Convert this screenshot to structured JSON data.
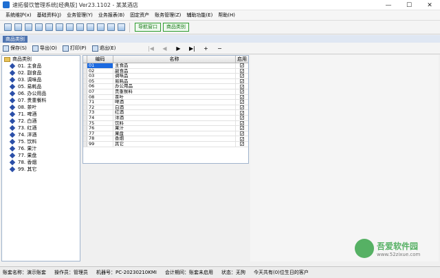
{
  "window": {
    "title": "速拓餐饮管理系统[经典版] Ver23.1102 - 某某酒店",
    "minimize": "—",
    "maximize": "☐",
    "close": "✕"
  },
  "menu": [
    "系统维护(x)",
    "基础资料(J)",
    "业务管理(Y)",
    "业务报表(B)",
    "固定资产",
    "账务管理(Z)",
    "辅助功能(E)",
    "帮助(H)"
  ],
  "toolbar": {
    "tab1": "导航窗口",
    "tab2": "商品类别"
  },
  "mdi_tab": "商品类别",
  "actions": {
    "save": "保存(S)",
    "export": "导出(O)",
    "print": "打印(P)",
    "exit": "退出(E)"
  },
  "nav": {
    "first": "|◀",
    "prev": "◀",
    "next": "▶",
    "last": "▶|",
    "add": "+",
    "remove": "−"
  },
  "tree": {
    "root": "商品类别",
    "items": [
      "01. 主食品",
      "02. 副食品",
      "03. 调味品",
      "05. 易耗品",
      "06. 办公用品",
      "07. 贵重餐料",
      "08. 茶叶",
      "71. 啤酒",
      "72. 白酒",
      "73. 红酒",
      "74. 洋酒",
      "75. 饮料",
      "76. 果汁",
      "77. 果盘",
      "78. 香烟",
      "99. 其它"
    ]
  },
  "grid": {
    "headers": {
      "code": "编码",
      "name": "名称",
      "enabled": "启用"
    },
    "rows": [
      {
        "code": "01",
        "name": "主食品",
        "enabled": true
      },
      {
        "code": "02",
        "name": "副食品",
        "enabled": true
      },
      {
        "code": "03",
        "name": "调味品",
        "enabled": true
      },
      {
        "code": "05",
        "name": "易耗品",
        "enabled": true
      },
      {
        "code": "06",
        "name": "办公用品",
        "enabled": true
      },
      {
        "code": "07",
        "name": "贵重餐料",
        "enabled": true
      },
      {
        "code": "08",
        "name": "茶叶",
        "enabled": true
      },
      {
        "code": "71",
        "name": "啤酒",
        "enabled": true
      },
      {
        "code": "72",
        "name": "白酒",
        "enabled": true
      },
      {
        "code": "73",
        "name": "红酒",
        "enabled": true
      },
      {
        "code": "74",
        "name": "洋酒",
        "enabled": true
      },
      {
        "code": "75",
        "name": "饮料",
        "enabled": true
      },
      {
        "code": "76",
        "name": "果汁",
        "enabled": true
      },
      {
        "code": "77",
        "name": "果盘",
        "enabled": true
      },
      {
        "code": "78",
        "name": "香烟",
        "enabled": true
      },
      {
        "code": "99",
        "name": "其它",
        "enabled": true
      }
    ]
  },
  "status": {
    "account": "账套名称：演示账套",
    "operator": "操作员：管理员",
    "machine": "机器号：PC-20230210KMI",
    "period": "会计期间：账套未启用",
    "state": "状态：无狗",
    "msg": "今天共有(0)位生日的客户"
  },
  "watermark": {
    "brand": "吾爱软件园",
    "url": "www.52zixue.com"
  }
}
